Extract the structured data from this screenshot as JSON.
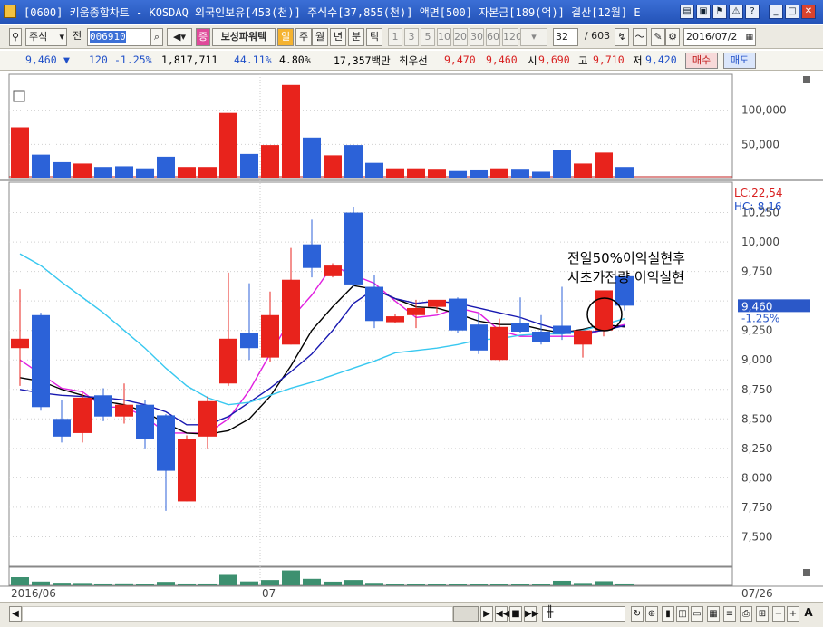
{
  "window": {
    "title": "[0600] 키움종합차트 - KOSDAQ 외국인보유[453(천)] 주식수[37,855(천)] 액면[500] 자본금[189(억)] 결산[12월] E"
  },
  "toolbar": {
    "market": "주식",
    "prefix": "전",
    "code": "006910",
    "indicator_btn": "보성파워텍",
    "period_il": "일",
    "period_ju": "주",
    "period_wol": "월",
    "period_nyeon": "년",
    "period_bun": "분",
    "period_tik": "틱",
    "n1": "1",
    "n3": "3",
    "n5": "5",
    "n10": "10",
    "n20": "20",
    "n30": "30",
    "n60": "60",
    "n120": "120",
    "count_input": "32",
    "count_total": "/ 603",
    "date": "2016/07/2"
  },
  "quote": {
    "price": "9,460",
    "arrow": "▼",
    "change": "120",
    "change_pct": "-1.25%",
    "volume": "1,817,711",
    "pct1": "44.11%",
    "pct2": "4.80%",
    "amount": "17,357백만",
    "best_label": "최우선",
    "best_ask": "9,470",
    "best_bid": "9,460",
    "open_label": "시",
    "open": "9,690",
    "high_label": "고",
    "high": "9,710",
    "low_label": "저",
    "low": "9,420",
    "buy_btn": "매수",
    "sell_btn": "매도"
  },
  "annotation": {
    "line1": "전일50%이익실현후",
    "line2": "시초가전량 이익실현"
  },
  "colors": {
    "up": "#e8231c",
    "down": "#2c62d8",
    "ma5": "#e020e0",
    "ma10": "#000000",
    "ma20": "#1818b0",
    "ma60": "#38c8f0",
    "vol_bar": "#3d9070"
  },
  "chart_data": {
    "type": "candlestick",
    "price_axis": {
      "min": 7250,
      "max": 10500,
      "ticks": [
        "10,250",
        "10,000",
        "9,750",
        "9,500",
        "9,250",
        "9,000",
        "8,750",
        "8,500",
        "8,250",
        "8,000",
        "7,750",
        "7,500"
      ],
      "current": "9,460",
      "current_change": "-1.25%",
      "lc_label": "LC:22,54",
      "hc_label": "HC:-8,16"
    },
    "volume_axis": {
      "ticks": [
        "100,000",
        "50,000"
      ]
    },
    "x_labels": [
      "2016/06",
      "07",
      "07/26"
    ],
    "candles": [
      {
        "o": 9100,
        "h": 9600,
        "l": 8780,
        "c": 9180,
        "up": true
      },
      {
        "o": 9380,
        "h": 9400,
        "l": 8570,
        "c": 8600,
        "up": false
      },
      {
        "o": 8500,
        "h": 8660,
        "l": 8300,
        "c": 8350,
        "up": false
      },
      {
        "o": 8380,
        "h": 8720,
        "l": 8300,
        "c": 8680,
        "up": true
      },
      {
        "o": 8700,
        "h": 8760,
        "l": 8480,
        "c": 8520,
        "up": false
      },
      {
        "o": 8520,
        "h": 8800,
        "l": 8460,
        "c": 8620,
        "up": true
      },
      {
        "o": 8620,
        "h": 8660,
        "l": 8250,
        "c": 8330,
        "up": false
      },
      {
        "o": 8530,
        "h": 8540,
        "l": 7720,
        "c": 8060,
        "up": false
      },
      {
        "o": 7800,
        "h": 8360,
        "l": 7800,
        "c": 8330,
        "up": true
      },
      {
        "o": 8350,
        "h": 8690,
        "l": 8250,
        "c": 8650,
        "up": true
      },
      {
        "o": 8800,
        "h": 9740,
        "l": 8780,
        "c": 9180,
        "up": true
      },
      {
        "o": 9100,
        "h": 9650,
        "l": 9000,
        "c": 9230,
        "up": false
      },
      {
        "o": 9020,
        "h": 9580,
        "l": 8980,
        "c": 9380,
        "up": true
      },
      {
        "o": 9130,
        "h": 9950,
        "l": 9130,
        "c": 9680,
        "up": true
      },
      {
        "o": 9980,
        "h": 10190,
        "l": 9700,
        "c": 9780,
        "up": false
      },
      {
        "o": 9710,
        "h": 9820,
        "l": 9700,
        "c": 9800,
        "up": true
      },
      {
        "o": 10250,
        "h": 10300,
        "l": 9620,
        "c": 9640,
        "up": false
      },
      {
        "o": 9620,
        "h": 9720,
        "l": 9270,
        "c": 9330,
        "up": false
      },
      {
        "o": 9320,
        "h": 9390,
        "l": 9310,
        "c": 9370,
        "up": true
      },
      {
        "o": 9380,
        "h": 9510,
        "l": 9270,
        "c": 9440,
        "up": true
      },
      {
        "o": 9450,
        "h": 9500,
        "l": 9400,
        "c": 9510,
        "up": true
      },
      {
        "o": 9520,
        "h": 9530,
        "l": 9230,
        "c": 9250,
        "up": false
      },
      {
        "o": 9300,
        "h": 9390,
        "l": 9050,
        "c": 9080,
        "up": false
      },
      {
        "o": 9000,
        "h": 9350,
        "l": 8990,
        "c": 9280,
        "up": true
      },
      {
        "o": 9310,
        "h": 9530,
        "l": 9230,
        "c": 9240,
        "up": false
      },
      {
        "o": 9240,
        "h": 9380,
        "l": 9130,
        "c": 9150,
        "up": false
      },
      {
        "o": 9290,
        "h": 9620,
        "l": 9170,
        "c": 9220,
        "up": false
      },
      {
        "o": 9130,
        "h": 9230,
        "l": 9020,
        "c": 9250,
        "up": true
      },
      {
        "o": 9250,
        "h": 9550,
        "l": 9200,
        "c": 9590,
        "up": true
      },
      {
        "o": 9710,
        "h": 9710,
        "l": 9420,
        "c": 9460,
        "up": false
      }
    ],
    "volumes": [
      {
        "v": 75000,
        "up": true
      },
      {
        "v": 35000,
        "up": false
      },
      {
        "v": 24000,
        "up": false
      },
      {
        "v": 22000,
        "up": true
      },
      {
        "v": 17000,
        "up": false
      },
      {
        "v": 18000,
        "up": false
      },
      {
        "v": 15000,
        "up": false
      },
      {
        "v": 32000,
        "up": false
      },
      {
        "v": 17000,
        "up": true
      },
      {
        "v": 17000,
        "up": true
      },
      {
        "v": 96000,
        "up": true
      },
      {
        "v": 36000,
        "up": false
      },
      {
        "v": 49000,
        "up": true
      },
      {
        "v": 137000,
        "up": true
      },
      {
        "v": 60000,
        "up": false
      },
      {
        "v": 34000,
        "up": true
      },
      {
        "v": 49000,
        "up": false
      },
      {
        "v": 23000,
        "up": false
      },
      {
        "v": 15000,
        "up": true
      },
      {
        "v": 15000,
        "up": true
      },
      {
        "v": 13000,
        "up": true
      },
      {
        "v": 11000,
        "up": false
      },
      {
        "v": 12000,
        "up": false
      },
      {
        "v": 15000,
        "up": true
      },
      {
        "v": 13000,
        "up": false
      },
      {
        "v": 10000,
        "up": false
      },
      {
        "v": 42000,
        "up": false
      },
      {
        "v": 22000,
        "up": true
      },
      {
        "v": 38000,
        "up": true
      },
      {
        "v": 17000,
        "up": false
      }
    ],
    "ma_series": [
      {
        "key": "ma5",
        "values": [
          9000,
          8880,
          8760,
          8730,
          8600,
          8600,
          8520,
          8380,
          8380,
          8380,
          8500,
          8740,
          9050,
          9350,
          9550,
          9800,
          9720,
          9650,
          9500,
          9360,
          9380,
          9440,
          9400,
          9250,
          9200,
          9200,
          9200,
          9200,
          9260,
          9300
        ]
      },
      {
        "key": "ma10",
        "values": [
          8850,
          8820,
          8750,
          8700,
          8650,
          8620,
          8560,
          8460,
          8380,
          8370,
          8400,
          8500,
          8690,
          8950,
          9250,
          9450,
          9630,
          9600,
          9520,
          9450,
          9440,
          9390,
          9330,
          9300,
          9300,
          9260,
          9230,
          9260,
          9300,
          9280
        ]
      },
      {
        "key": "ma20",
        "values": [
          8750,
          8720,
          8700,
          8690,
          8680,
          8660,
          8620,
          8560,
          8450,
          8450,
          8520,
          8640,
          8760,
          8900,
          9050,
          9250,
          9480,
          9600,
          9520,
          9480,
          9500,
          9480,
          9440,
          9400,
          9360,
          9300,
          9250,
          9230,
          9250,
          9290
        ]
      },
      {
        "key": "ma60",
        "values": [
          9900,
          9800,
          9660,
          9530,
          9400,
          9250,
          9100,
          8930,
          8780,
          8680,
          8620,
          8640,
          8700,
          8760,
          8810,
          8870,
          8930,
          8990,
          9060,
          9080,
          9100,
          9130,
          9170,
          9180,
          9210,
          9220,
          9220,
          9250,
          9300,
          9350
        ]
      }
    ]
  }
}
